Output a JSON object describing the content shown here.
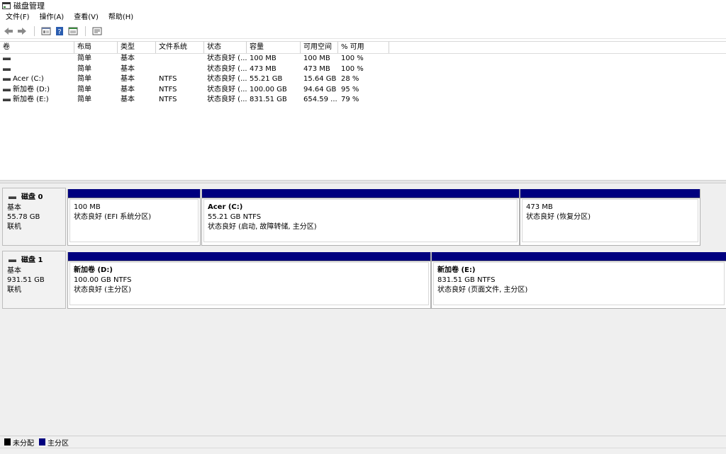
{
  "window": {
    "title": "磁盘管理"
  },
  "menu": [
    "文件(F)",
    "操作(A)",
    "查看(V)",
    "帮助(H)"
  ],
  "toolbar": [
    "back-icon",
    "forward-icon",
    "properties-icon",
    "help-icon",
    "console-icon",
    "view-icon"
  ],
  "volume_list": {
    "columns": [
      "卷",
      "布局",
      "类型",
      "文件系统",
      "状态",
      "容量",
      "可用空间",
      "% 可用"
    ],
    "rows": [
      {
        "name": "",
        "layout": "简单",
        "type": "基本",
        "fs": "",
        "status": "状态良好 (...",
        "capacity": "100 MB",
        "free": "100 MB",
        "pct": "100 %"
      },
      {
        "name": "",
        "layout": "简单",
        "type": "基本",
        "fs": "",
        "status": "状态良好 (...",
        "capacity": "473 MB",
        "free": "473 MB",
        "pct": "100 %"
      },
      {
        "name": "Acer (C:)",
        "layout": "简单",
        "type": "基本",
        "fs": "NTFS",
        "status": "状态良好 (...",
        "capacity": "55.21 GB",
        "free": "15.64 GB",
        "pct": "28 %"
      },
      {
        "name": "新加卷 (D:)",
        "layout": "简单",
        "type": "基本",
        "fs": "NTFS",
        "status": "状态良好 (...",
        "capacity": "100.00 GB",
        "free": "94.64 GB",
        "pct": "95 %"
      },
      {
        "name": "新加卷 (E:)",
        "layout": "简单",
        "type": "基本",
        "fs": "NTFS",
        "status": "状态良好 (...",
        "capacity": "831.51 GB",
        "free": "654.59 ...",
        "pct": "79 %"
      }
    ]
  },
  "disks": [
    {
      "name": "磁盘 0",
      "type": "基本",
      "size": "55.78 GB",
      "state": "联机",
      "partitions": [
        {
          "name": "",
          "size": "100 MB",
          "status": "状态良好 (EFI 系统分区)"
        },
        {
          "name": "Acer  (C:)",
          "size": "55.21 GB NTFS",
          "status": "状态良好 (启动, 故障转储, 主分区)"
        },
        {
          "name": "",
          "size": "473 MB",
          "status": "状态良好 (恢复分区)"
        }
      ]
    },
    {
      "name": "磁盘 1",
      "type": "基本",
      "size": "931.51 GB",
      "state": "联机",
      "partitions": [
        {
          "name": "新加卷  (D:)",
          "size": "100.00 GB NTFS",
          "status": "状态良好 (主分区)"
        },
        {
          "name": "新加卷  (E:)",
          "size": "831.51 GB NTFS",
          "status": "状态良好 (页面文件, 主分区)"
        }
      ]
    }
  ],
  "legend": [
    {
      "label": "未分配",
      "color": "#000000"
    },
    {
      "label": "主分区",
      "color": "#00007f"
    }
  ]
}
